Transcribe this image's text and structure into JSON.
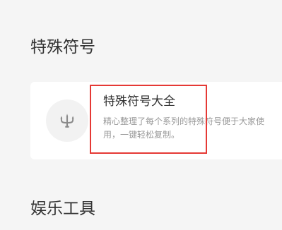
{
  "sections": {
    "special_symbols": {
      "title": "特殊符号"
    },
    "entertainment_tools": {
      "title": "娱乐工具"
    }
  },
  "tool_card": {
    "name": "特殊符号大全",
    "description": "精心整理了每个系列的特殊符号便于大家使用，一键轻松复制。",
    "icon": "trident-icon"
  },
  "colors": {
    "background": "#f5f5f5",
    "card": "#ffffff",
    "icon_circle": "#f2f2f2",
    "icon": "#8a8a8a",
    "highlight": "#e53935",
    "title_text": "#333333",
    "description_text": "#999999"
  }
}
